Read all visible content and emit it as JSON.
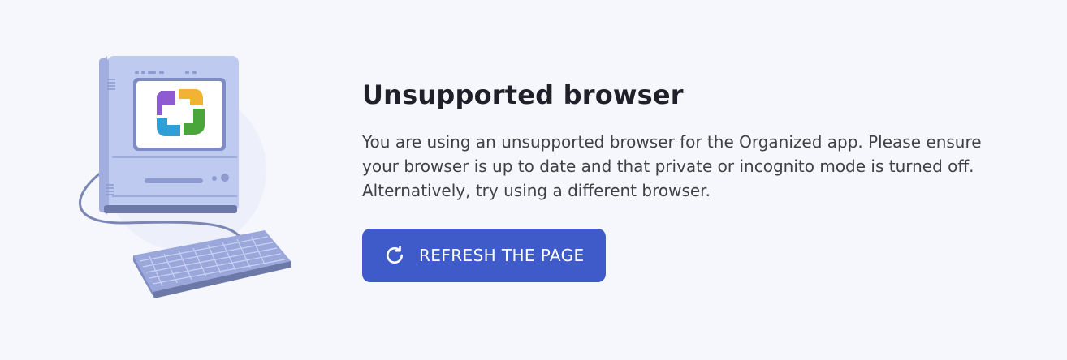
{
  "illustration": {
    "icon": "retro-computer-with-app-logo",
    "logo_colors": [
      "#8e5bd0",
      "#f2b233",
      "#4aa63a",
      "#2f9fd8"
    ]
  },
  "content": {
    "title": "Unsupported browser",
    "message": "You are using an unsupported browser for the Organized app. Please ensure your browser is up to date and that private or incognito mode is turned off. Alternatively, try using a different browser."
  },
  "actions": {
    "refresh_label": "REFRESH THE PAGE",
    "refresh_icon": "refresh-icon"
  },
  "colors": {
    "accent": "#3f5bc9",
    "background": "#f6f7fd",
    "title": "#1f2029",
    "text": "#3f4147"
  }
}
